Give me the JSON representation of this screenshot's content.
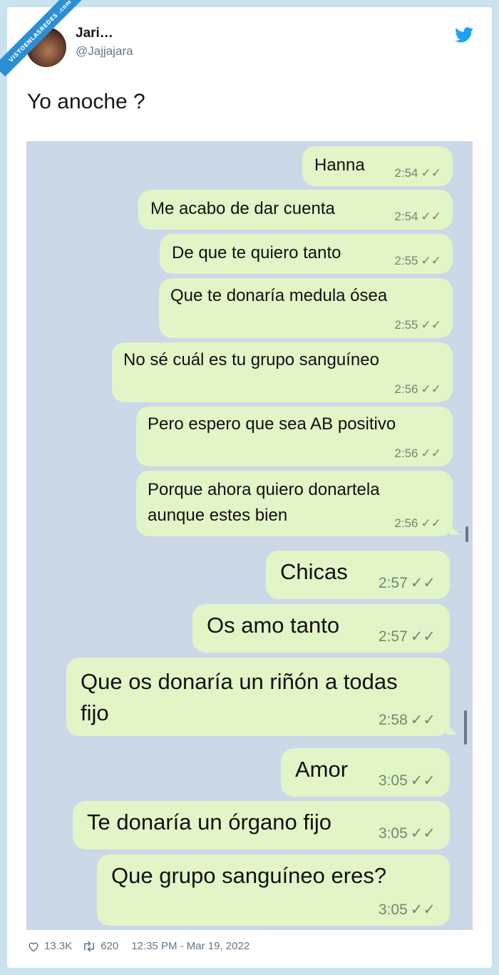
{
  "watermark": "VISTOENLASREDES .com",
  "user": {
    "name": "Jari…",
    "handle": "@Jajjajara"
  },
  "tweet": {
    "text": "Yo anoche ?"
  },
  "messages": [
    {
      "text": "Hanna",
      "time": "2:54"
    },
    {
      "text": "Me acabo de dar cuenta",
      "time": "2:54"
    },
    {
      "text": "De que te quiero tanto",
      "time": "2:55"
    },
    {
      "text": "Que te donaría medula ósea",
      "time": "2:55"
    },
    {
      "text": "No sé cuál es tu grupo sanguíneo",
      "time": "2:56"
    },
    {
      "text": "Pero espero que sea AB positivo",
      "time": "2:56"
    },
    {
      "text": "Porque ahora quiero donartela\naunque estes bien",
      "time": "2:56"
    },
    {
      "text": "Chicas",
      "time": "2:57"
    },
    {
      "text": "Os amo tanto",
      "time": "2:57"
    },
    {
      "text": "Que os donaría un riñón a todas\nfijo",
      "time": "2:58"
    },
    {
      "text": "Amor",
      "time": "3:05"
    },
    {
      "text": "Te donaría un órgano fijo",
      "time": "3:05"
    },
    {
      "text": "Que grupo sanguíneo eres?",
      "time": "3:05"
    }
  ],
  "footer": {
    "likes": "13.3K",
    "retweets": "620",
    "timestamp": "12:35 PM - Mar 19, 2022"
  },
  "colors": {
    "bubble": "#e1f5c7",
    "chat_bg": "#cbd8e8",
    "twitter_blue": "#1da1f2"
  }
}
